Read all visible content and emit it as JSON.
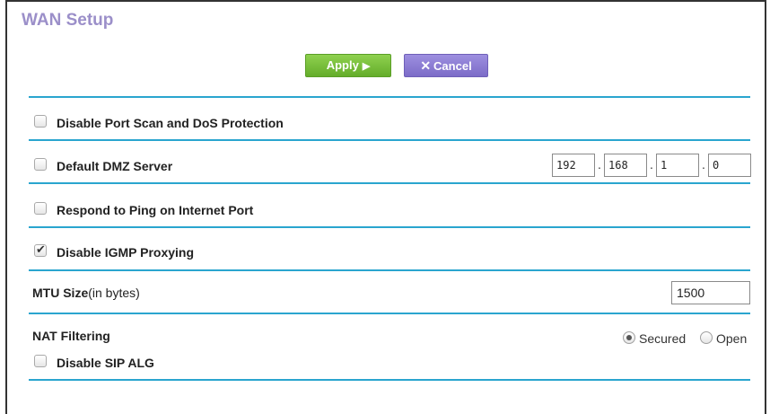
{
  "page": {
    "title": "WAN Setup"
  },
  "buttons": {
    "apply": "Apply",
    "cancel": "Cancel"
  },
  "options": {
    "port_scan": {
      "label": "Disable Port Scan and DoS Protection",
      "checked": false
    },
    "dmz": {
      "label": "Default DMZ Server",
      "checked": false,
      "ip": [
        "192",
        "168",
        "1",
        "0"
      ]
    },
    "ping": {
      "label": "Respond to Ping on Internet Port",
      "checked": false
    },
    "igmp": {
      "label": "Disable IGMP Proxying",
      "checked": true
    }
  },
  "mtu": {
    "label_bold": "MTU Size",
    "label_suffix": "(in bytes)",
    "value": "1500"
  },
  "nat": {
    "label": "NAT Filtering",
    "secured": "Secured",
    "open": "Open",
    "selected": "Secured"
  },
  "sip": {
    "label": "Disable SIP ALG",
    "checked": false
  },
  "colors": {
    "title": "#9b8fc9",
    "divider": "#2aa5cf",
    "apply": "#74bd35",
    "cancel": "#8a7bd6"
  }
}
